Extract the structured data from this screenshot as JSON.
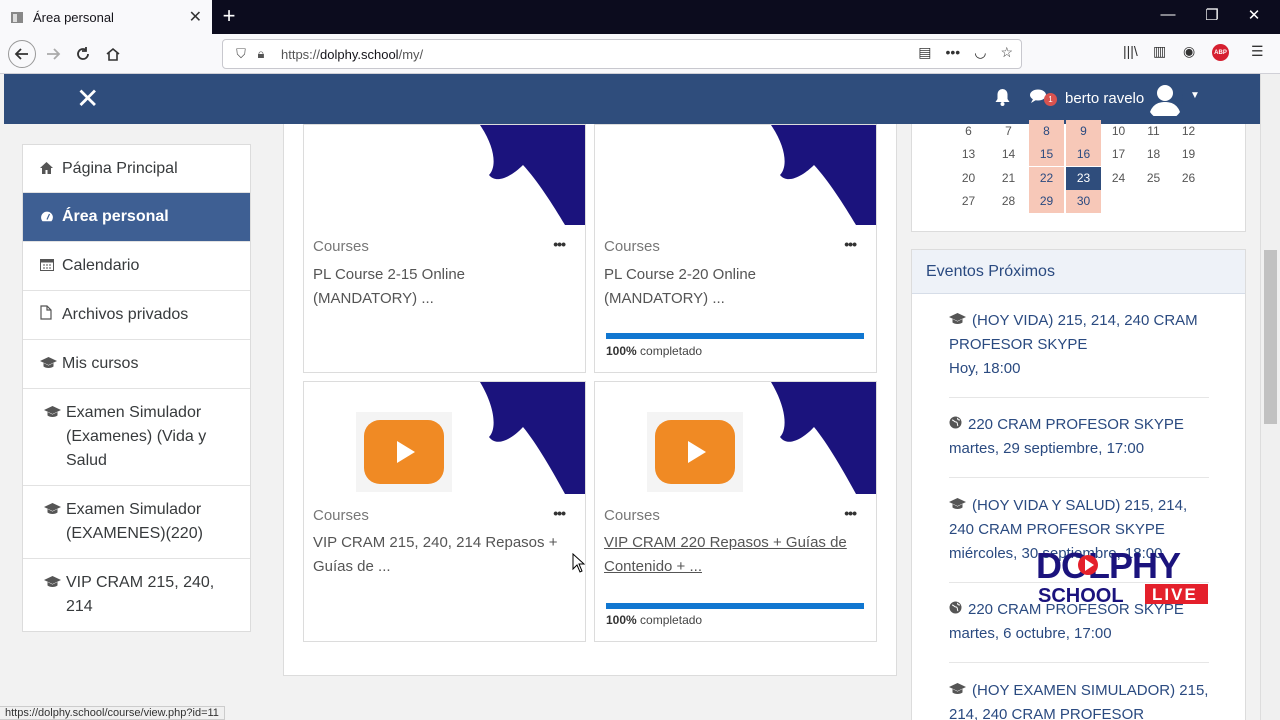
{
  "browser": {
    "tab_title": "Área personal",
    "tab_close": "✕",
    "new_tab": "+",
    "url_scheme": "https://",
    "url_host": "dolphy.school",
    "url_path": "/my/",
    "status_url": "https://dolphy.school/course/view.php?id=11"
  },
  "header": {
    "close_glyph": "✕",
    "notification_count": "1",
    "user_name": "berto ravelo"
  },
  "sidebar": {
    "items": [
      {
        "label": "Página Principal",
        "icon": "home-icon"
      },
      {
        "label": "Área personal",
        "icon": "dashboard-icon"
      },
      {
        "label": "Calendario",
        "icon": "calendar-icon"
      },
      {
        "label": "Archivos privados",
        "icon": "file-icon"
      },
      {
        "label": "Mis cursos",
        "icon": "graduation-cap-icon"
      },
      {
        "label": "Examen Simulador (Examenes) (Vida y Salud",
        "icon": "graduation-cap-icon"
      },
      {
        "label": "Examen Simulador (EXAMENES)(220)",
        "icon": "graduation-cap-icon"
      },
      {
        "label": "VIP CRAM 215, 240, 214",
        "icon": "graduation-cap-icon"
      }
    ]
  },
  "courses": [
    {
      "category": "Courses",
      "title": "PL Course 2-15 Online (MANDATORY) ..."
    },
    {
      "category": "Courses",
      "title": "PL Course 2-20 Online (MANDATORY) ...",
      "progress": 100,
      "progress_pct": "100%",
      "progress_text": "completado"
    },
    {
      "category": "Courses",
      "title": "VIP CRAM 215, 240, 214 Repasos + Guías de ..."
    },
    {
      "category": "Courses",
      "title": "VIP CRAM 220 Repasos + Guías de Contenido + ...",
      "progress": 100,
      "progress_pct": "100%",
      "progress_text": "completado"
    }
  ],
  "calendar": {
    "rows": [
      [
        "6",
        "7",
        "8",
        "9",
        "10",
        "11",
        "12"
      ],
      [
        "13",
        "14",
        "15",
        "16",
        "17",
        "18",
        "19"
      ],
      [
        "20",
        "21",
        "22",
        "23",
        "24",
        "25",
        "26"
      ],
      [
        "27",
        "28",
        "29",
        "30",
        "",
        "",
        ""
      ]
    ],
    "today": "23",
    "highlight_color": "#f7c8b8",
    "today_color": "#2f4d7c"
  },
  "events": {
    "heading": "Eventos Próximos",
    "items": [
      {
        "title": "(HOY VIDA) 215, 214, 240 CRAM PROFESOR SKYPE",
        "time": "Hoy, 18:00",
        "icon": "graduation-cap-icon"
      },
      {
        "title": "220 CRAM PROFESOR SKYPE",
        "time": "martes, 29 septiembre, 17:00",
        "icon": "globe-icon"
      },
      {
        "title": "(HOY VIDA Y SALUD) 215, 214, 240 CRAM PROFESOR SKYPE",
        "time": "miércoles, 30 septiembre, 18:00",
        "icon": "graduation-cap-icon"
      },
      {
        "title": "220 CRAM PROFESOR SKYPE",
        "time": "martes, 6 octubre, 17:00",
        "icon": "globe-icon"
      },
      {
        "title": "(HOY EXAMEN SIMULADOR) 215, 214, 240 CRAM PROFESOR",
        "time": "",
        "icon": "graduation-cap-icon"
      }
    ]
  },
  "watermark": {
    "line1": "DOLPHY",
    "line2": "SCHOOL",
    "badge": "LIVE"
  },
  "colors": {
    "navbar": "#2f4d7c",
    "sidebar_active": "#3e5f93",
    "progress": "#1177d1",
    "play_button": "#f08a24",
    "map": "#1b137d"
  }
}
